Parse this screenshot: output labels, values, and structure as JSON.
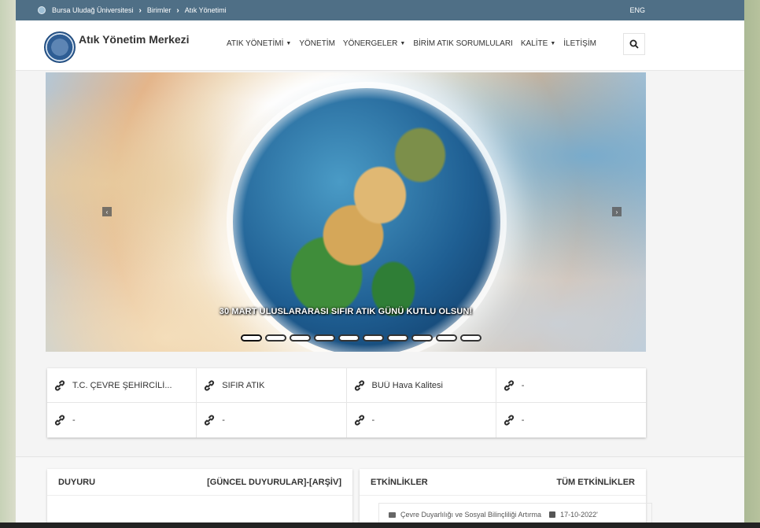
{
  "topbar": {
    "breadcrumb": [
      "Bursa Uludağ Üniversitesi",
      "Birimler",
      "Atık Yönetimi"
    ],
    "lang": "ENG"
  },
  "header": {
    "title": "Atık Yönetim Merkezi",
    "nav": [
      {
        "label": "ATIK YÖNETİMİ",
        "dropdown": true
      },
      {
        "label": "YÖNETİM",
        "dropdown": false
      },
      {
        "label": "YÖNERGELER",
        "dropdown": true
      },
      {
        "label": "BİRİM ATIK SORUMLULARI",
        "dropdown": false
      },
      {
        "label": "KALİTE",
        "dropdown": true
      },
      {
        "label": "İLETİŞİM",
        "dropdown": false
      }
    ]
  },
  "slider": {
    "caption": "30 MART ULUSLARARASI SIFIR ATIK GÜNÜ KUTLU OLSUN!",
    "slide_count": 10,
    "active_slide": 1
  },
  "quick_links": [
    {
      "label": "T.C. ÇEVRE ŞEHİRCİLİ..."
    },
    {
      "label": "SIFIR ATIK"
    },
    {
      "label": "BUÜ Hava Kalitesi"
    },
    {
      "label": "-"
    },
    {
      "label": "-"
    },
    {
      "label": "-"
    },
    {
      "label": "-"
    },
    {
      "label": "-"
    }
  ],
  "duyuru": {
    "title": "DUYURU",
    "links": "[GÜNCEL DUYURULAR]-[ARŞİV]"
  },
  "etkinlikler": {
    "title": "ETKİNLİKLER",
    "all_link": "TÜM ETKİNLİKLER",
    "items": [
      {
        "title": "Çevre Duyarlılığı ve Sosyal Bilinçliliği Artırma",
        "date": "17-10-2022'"
      }
    ]
  },
  "colors": {
    "topbar": "#4f6f86",
    "link_icon": "#2d2d2d"
  }
}
